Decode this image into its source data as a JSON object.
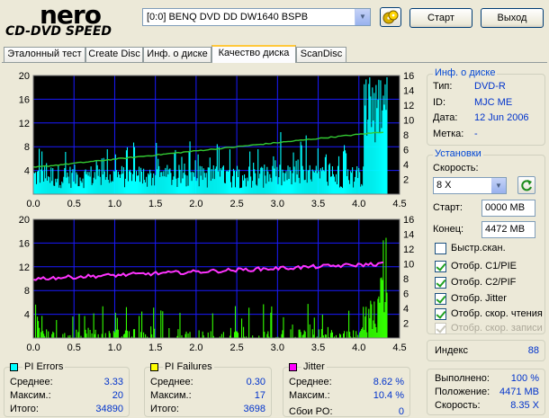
{
  "app": {
    "logo_top": "nero",
    "logo_bottom": "CD-DVD SPEED"
  },
  "header": {
    "drive": "[0:0]  BENQ DVD DD DW1640 BSPB",
    "start_label": "Старт",
    "exit_label": "Выход",
    "eject_icon": "eject-disc-icon"
  },
  "tabs": [
    {
      "label": "Эталонный тест"
    },
    {
      "label": "Create Disc"
    },
    {
      "label": "Инф. о диске"
    },
    {
      "label": "Качество диска",
      "active": true
    },
    {
      "label": "ScanDisc"
    }
  ],
  "chart_data": [
    {
      "type": "bar",
      "name": "PI Errors / Read speed",
      "x_range": [
        0.0,
        4.5
      ],
      "x_ticks": [
        "0.0",
        "0.5",
        "1.0",
        "1.5",
        "2.0",
        "2.5",
        "3.0",
        "3.5",
        "4.0",
        "4.5"
      ],
      "y_left_ticks": [
        "20",
        "16",
        "12",
        "8",
        "4"
      ],
      "y_left_range": [
        0,
        20
      ],
      "y_right_ticks": [
        "16",
        "14",
        "12",
        "10",
        "8",
        "6",
        "4",
        "2"
      ],
      "y_right_range": [
        0,
        16
      ],
      "series": [
        {
          "kind": "bar",
          "color": "#00ffff",
          "x_step": 0.01,
          "avg": 3.33,
          "max": 20
        },
        {
          "kind": "line",
          "color": "#33cc33",
          "unit": "X",
          "x": [
            0.0,
            4.3
          ],
          "y": [
            3.6,
            8.4
          ]
        }
      ],
      "grid": true
    },
    {
      "type": "bar",
      "name": "PI Failures / Jitter",
      "x_range": [
        0.0,
        4.5
      ],
      "x_ticks": [
        "0.0",
        "0.5",
        "1.0",
        "1.5",
        "2.0",
        "2.5",
        "3.0",
        "3.5",
        "4.0",
        "4.5"
      ],
      "y_left_ticks": [
        "20",
        "16",
        "12",
        "8",
        "4"
      ],
      "y_left_range": [
        0,
        20
      ],
      "y_right_ticks": [
        "16",
        "14",
        "12",
        "10",
        "8",
        "6",
        "4",
        "2"
      ],
      "y_right_range": [
        0,
        16
      ],
      "series": [
        {
          "kind": "bar",
          "color": "#33ff00",
          "avg": 0.3,
          "max": 17
        },
        {
          "kind": "line",
          "color": "#ff33ff",
          "unit": "%",
          "x": [
            0.0,
            4.3
          ],
          "y": [
            8.0,
            10.0
          ]
        }
      ],
      "grid": true
    }
  ],
  "disc_info": {
    "title": "Инф. о диске",
    "rows": [
      {
        "label": "Тип:",
        "value": "DVD-R"
      },
      {
        "label": "ID:",
        "value": "MJC ME"
      },
      {
        "label": "Дата:",
        "value": "12 Jun 2006"
      },
      {
        "label": "Метка:",
        "value": "-"
      }
    ]
  },
  "settings": {
    "title": "Установки",
    "speed_label": "Скорость:",
    "speed_value": "8 X",
    "refresh_icon": "refresh-icon",
    "start_label": "Старт:",
    "start_value": "0000 MB",
    "end_label": "Конец:",
    "end_value": "4472 MB",
    "checks": [
      {
        "label": "Быстр.скан.",
        "checked": false,
        "disabled": false
      },
      {
        "label": "Отобр. C1/PIE",
        "checked": true,
        "disabled": false
      },
      {
        "label": "Отобр. C2/PIF",
        "checked": true,
        "disabled": false
      },
      {
        "label": "Отобр. Jitter",
        "checked": true,
        "disabled": false
      },
      {
        "label": "Отобр. скор. чтения",
        "checked": true,
        "disabled": false
      },
      {
        "label": "Отобр. скор. записи",
        "checked": true,
        "disabled": true
      }
    ]
  },
  "index": {
    "label": "Индекс",
    "value": "88"
  },
  "progress": {
    "rows": [
      {
        "label": "Выполнено:",
        "value": "100 %"
      },
      {
        "label": "Положение:",
        "value": "4471 MB"
      },
      {
        "label": "Скорость:",
        "value": "8.35 X"
      }
    ]
  },
  "stats": {
    "pi_errors": {
      "title": "PI Errors",
      "color": "#00ffff",
      "avg_label": "Среднее:",
      "avg": "3.33",
      "max_label": "Максим.:",
      "max": "20",
      "total_label": "Итого:",
      "total": "34890"
    },
    "pi_failures": {
      "title": "PI Failures",
      "color": "#ffff00",
      "avg_label": "Среднее:",
      "avg": "0.30",
      "max_label": "Максим.:",
      "max": "17",
      "total_label": "Итого:",
      "total": "3698"
    },
    "jitter": {
      "title": "Jitter",
      "color": "#ff00ff",
      "avg_label": "Среднее:",
      "avg": "8.62 %",
      "max_label": "Максим.:",
      "max": "10.4 %",
      "po_label": "Сбои PO:",
      "po": "0"
    }
  }
}
